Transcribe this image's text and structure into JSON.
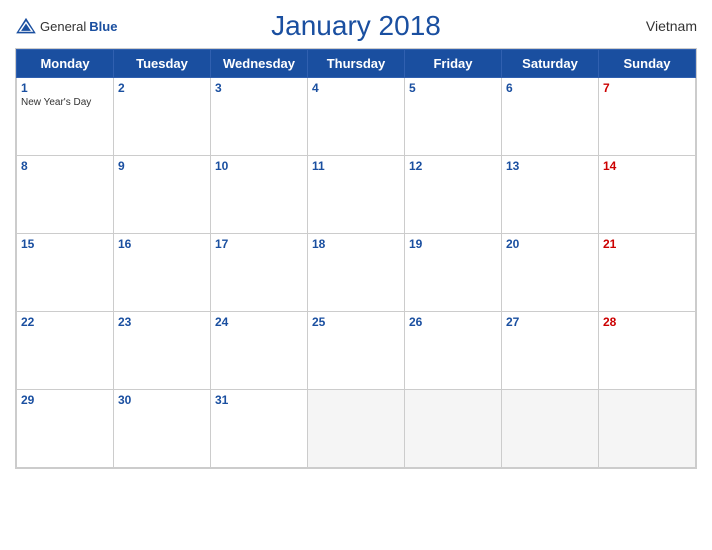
{
  "header": {
    "title": "January 2018",
    "country": "Vietnam",
    "logo_general": "General",
    "logo_blue": "Blue"
  },
  "days": [
    "Monday",
    "Tuesday",
    "Wednesday",
    "Thursday",
    "Friday",
    "Saturday",
    "Sunday"
  ],
  "weeks": [
    [
      {
        "num": "1",
        "holiday": "New Year's Day",
        "sunday": false
      },
      {
        "num": "2",
        "holiday": "",
        "sunday": false
      },
      {
        "num": "3",
        "holiday": "",
        "sunday": false
      },
      {
        "num": "4",
        "holiday": "",
        "sunday": false
      },
      {
        "num": "5",
        "holiday": "",
        "sunday": false
      },
      {
        "num": "6",
        "holiday": "",
        "sunday": false
      },
      {
        "num": "7",
        "holiday": "",
        "sunday": true
      }
    ],
    [
      {
        "num": "8",
        "holiday": "",
        "sunday": false
      },
      {
        "num": "9",
        "holiday": "",
        "sunday": false
      },
      {
        "num": "10",
        "holiday": "",
        "sunday": false
      },
      {
        "num": "11",
        "holiday": "",
        "sunday": false
      },
      {
        "num": "12",
        "holiday": "",
        "sunday": false
      },
      {
        "num": "13",
        "holiday": "",
        "sunday": false
      },
      {
        "num": "14",
        "holiday": "",
        "sunday": true
      }
    ],
    [
      {
        "num": "15",
        "holiday": "",
        "sunday": false
      },
      {
        "num": "16",
        "holiday": "",
        "sunday": false
      },
      {
        "num": "17",
        "holiday": "",
        "sunday": false
      },
      {
        "num": "18",
        "holiday": "",
        "sunday": false
      },
      {
        "num": "19",
        "holiday": "",
        "sunday": false
      },
      {
        "num": "20",
        "holiday": "",
        "sunday": false
      },
      {
        "num": "21",
        "holiday": "",
        "sunday": true
      }
    ],
    [
      {
        "num": "22",
        "holiday": "",
        "sunday": false
      },
      {
        "num": "23",
        "holiday": "",
        "sunday": false
      },
      {
        "num": "24",
        "holiday": "",
        "sunday": false
      },
      {
        "num": "25",
        "holiday": "",
        "sunday": false
      },
      {
        "num": "26",
        "holiday": "",
        "sunday": false
      },
      {
        "num": "27",
        "holiday": "",
        "sunday": false
      },
      {
        "num": "28",
        "holiday": "",
        "sunday": true
      }
    ],
    [
      {
        "num": "29",
        "holiday": "",
        "sunday": false
      },
      {
        "num": "30",
        "holiday": "",
        "sunday": false
      },
      {
        "num": "31",
        "holiday": "",
        "sunday": false
      },
      {
        "num": "",
        "holiday": "",
        "sunday": false,
        "empty": true
      },
      {
        "num": "",
        "holiday": "",
        "sunday": false,
        "empty": true
      },
      {
        "num": "",
        "holiday": "",
        "sunday": false,
        "empty": true
      },
      {
        "num": "",
        "holiday": "",
        "sunday": true,
        "empty": true
      }
    ]
  ]
}
